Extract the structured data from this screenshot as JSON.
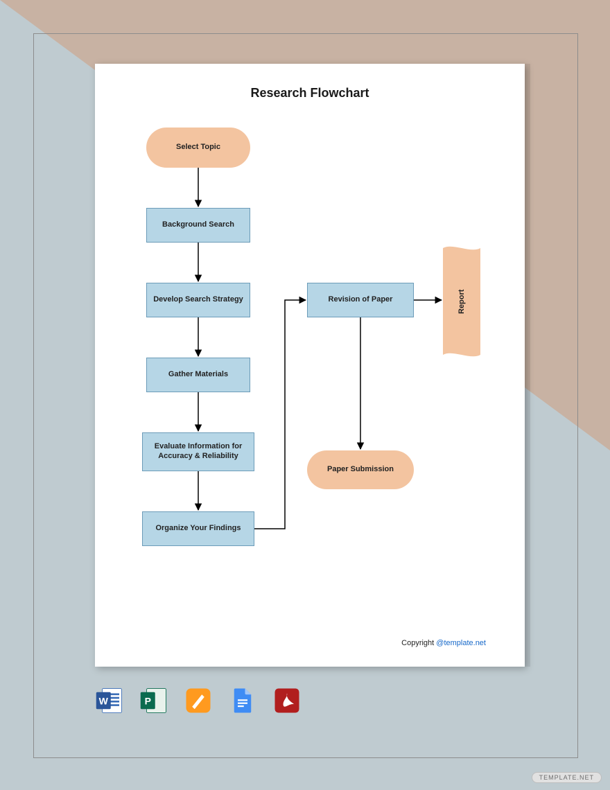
{
  "diagram": {
    "title": "Research Flowchart",
    "nodes": {
      "select_topic": "Select Topic",
      "background_search": "Background Search",
      "develop_strategy": "Develop Search Strategy",
      "gather_materials": "Gather Materials",
      "evaluate_info": "Evaluate Information for Accuracy & Reliability",
      "organize_findings": "Organize Your Findings",
      "revision_paper": "Revision of Paper",
      "paper_submission": "Paper Submission",
      "report": "Report"
    },
    "copyright_prefix": "Copyright ",
    "copyright_link": "@template.net"
  },
  "icons": {
    "word": "word-icon",
    "publisher": "publisher-icon",
    "pages": "pages-icon",
    "gdocs": "google-docs-icon",
    "pdf": "pdf-icon"
  },
  "watermark": "TEMPLATE.NET"
}
